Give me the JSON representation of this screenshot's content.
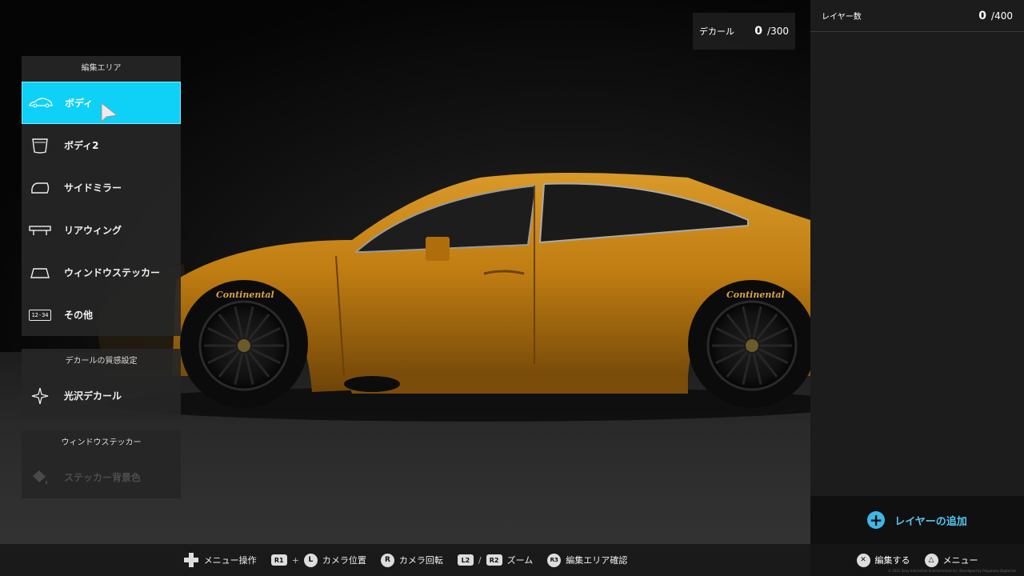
{
  "decal_counter": {
    "label": "デカール",
    "count": "0",
    "max": "/300"
  },
  "edit_area": {
    "header": "編集エリア",
    "items": [
      {
        "label": "ボディ",
        "icon": "car-body-icon",
        "selected": true
      },
      {
        "label": "ボディ2",
        "icon": "car-front-icon"
      },
      {
        "label": "サイドミラー",
        "icon": "side-mirror-icon"
      },
      {
        "label": "リアウィング",
        "icon": "rear-wing-icon"
      },
      {
        "label": "ウィンドウステッカー",
        "icon": "window-icon"
      },
      {
        "label": "その他",
        "icon": "license-plate-icon",
        "plate_text": "12-34"
      }
    ]
  },
  "decal_texture": {
    "header": "デカールの質感設定",
    "items": [
      {
        "label": "光沢デカール",
        "icon": "sparkle-icon"
      }
    ]
  },
  "window_sticker": {
    "header": "ウィンドウステッカー",
    "items": [
      {
        "label": "ステッカー背景色",
        "icon": "paint-bucket-icon",
        "disabled": true
      }
    ]
  },
  "layers": {
    "label": "レイヤー数",
    "count": "0",
    "max": "/400",
    "add_label": "レイヤーの追加"
  },
  "car": {
    "body_color": "#c07d12",
    "tire_brand": "Continental"
  },
  "bottom_hints": {
    "menu_op": "メニュー操作",
    "r1": "R1",
    "plus": "+",
    "l_stick": "L",
    "camera_pos": "カメラ位置",
    "r_stick": "R",
    "camera_rot": "カメラ回転",
    "l2": "L2",
    "slash": "/",
    "r2": "R2",
    "zoom": "ズーム",
    "r3": "R3",
    "edit_area_confirm": "編集エリア確認",
    "cross_sym": "✕",
    "edit": "編集する",
    "triangle_sym": "△",
    "menu": "メニュー"
  },
  "copyright": "© 2022 Sony Interactive Entertainment Inc. Developed by Polyphony Digital Inc.",
  "colors": {
    "accent": "#0fd0f7",
    "add_layer": "#55c4f0"
  }
}
